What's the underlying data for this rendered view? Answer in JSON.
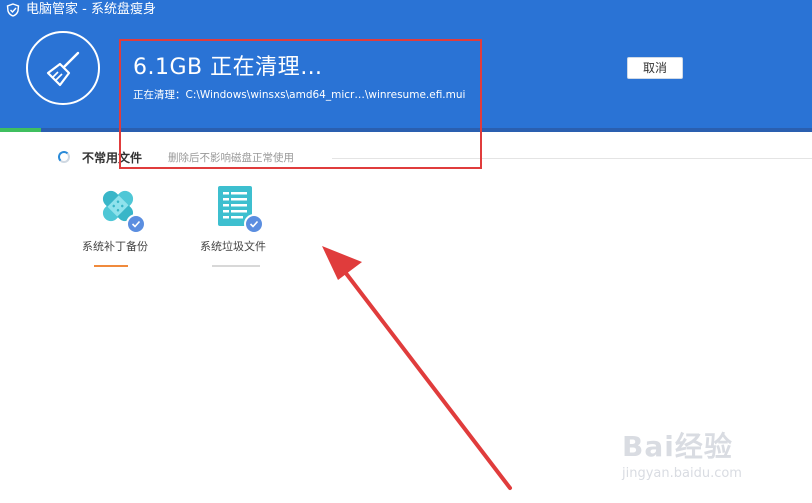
{
  "titlebar": {
    "title": "电脑管家 - 系统盘瘦身"
  },
  "header": {
    "size_text": "6.1GB 正在清理…",
    "cleaning_path": "正在清理：C:\\Windows\\winsxs\\amd64_micr…\\winresume.efi.mui",
    "cancel_label": "取消",
    "progress_fraction": 0.05
  },
  "section": {
    "title": "不常用文件",
    "description": "删除后不影响磁盘正常使用"
  },
  "items": [
    {
      "label": "系统补丁备份",
      "icon": "bandage-icon",
      "checked": true,
      "underline_color": "#f08a3c"
    },
    {
      "label": "系统垃圾文件",
      "icon": "document-list-icon",
      "checked": true,
      "underline_color": "#d8d8d8"
    }
  ],
  "watermark": {
    "logo": "Bai经验",
    "url": "jingyan.baidu.com"
  },
  "colors": {
    "header": "#2a73d5",
    "progress": "#3fbf5f",
    "annotation": "#e03c3c",
    "accent": "#2a8ad8"
  }
}
